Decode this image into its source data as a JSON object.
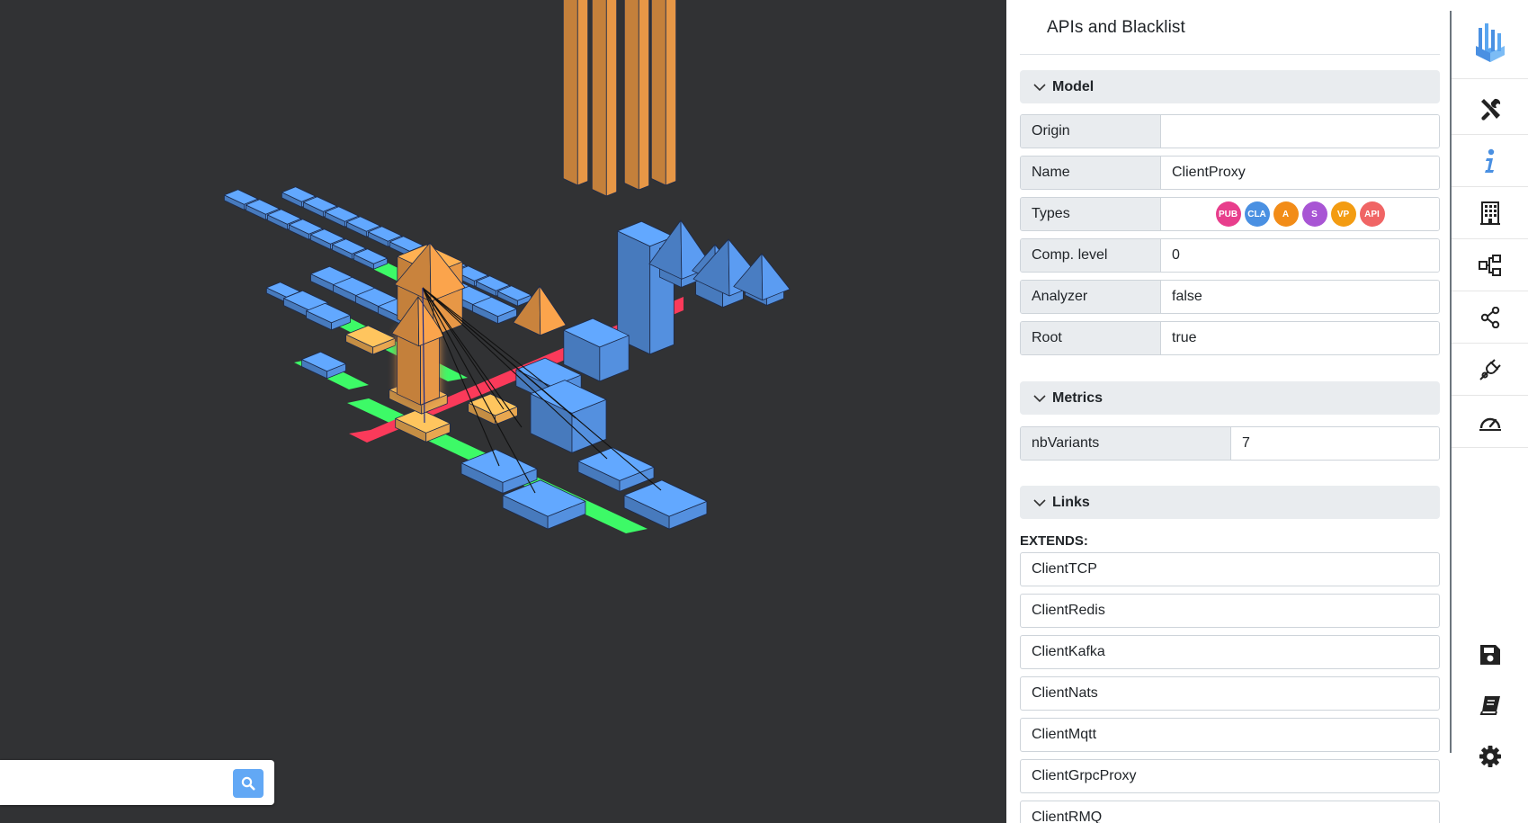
{
  "panel": {
    "title": "APIs and Blacklist",
    "sections": {
      "model": "Model",
      "metrics": "Metrics",
      "links": "Links"
    },
    "model_rows": [
      {
        "key": "Origin",
        "value": ""
      },
      {
        "key": "Name",
        "value": "ClientProxy"
      },
      {
        "key": "Types",
        "value": ""
      },
      {
        "key": "Comp. level",
        "value": "0"
      },
      {
        "key": "Analyzer",
        "value": "false"
      },
      {
        "key": "Root",
        "value": "true"
      }
    ],
    "types_badges": [
      {
        "label": "PUB",
        "color": "#e83e8c"
      },
      {
        "label": "CLA",
        "color": "#4a90e2"
      },
      {
        "label": "A",
        "color": "#f28c18"
      },
      {
        "label": "S",
        "color": "#a855d4"
      },
      {
        "label": "VP",
        "color": "#f39c12"
      },
      {
        "label": "API",
        "color": "#f06565"
      }
    ],
    "metrics_rows": [
      {
        "key": "nbVariants",
        "value": "7"
      }
    ],
    "extends_label": "EXTENDS:",
    "extends": [
      "ClientTCP",
      "ClientRedis",
      "ClientKafka",
      "ClientNats",
      "ClientMqtt",
      "ClientGrpcProxy",
      "ClientRMQ"
    ]
  },
  "search": {
    "value": "",
    "placeholder": ""
  },
  "toolbar": {
    "icons": [
      "app-logo-icon",
      "tools-icon",
      "info-icon",
      "building-icon",
      "hierarchy-icon",
      "share-icon",
      "plug-icon",
      "speedometer-icon",
      "save-icon",
      "book-icon",
      "gear-icon"
    ],
    "active": "info-icon",
    "accent": "#4a90e2"
  },
  "scene": {
    "background": "#313234",
    "colors": {
      "class": "#5b9cf2",
      "api": "#fba44c",
      "api_light": "#fcb657",
      "street_green": "#3dfa67",
      "street_red": "#fb3a5a"
    }
  }
}
